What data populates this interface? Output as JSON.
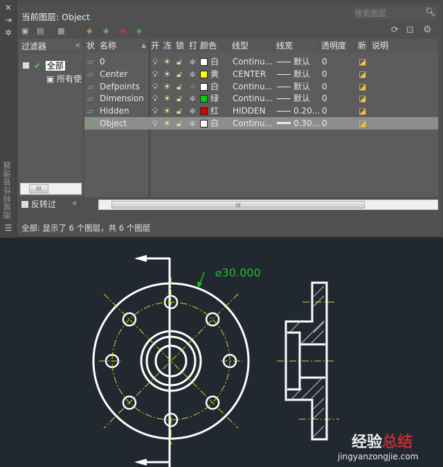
{
  "panel": {
    "title": "当前图层: Object",
    "search_placeholder": "搜索图层",
    "vertical_title": "图层特性管理器",
    "status": "全部: 显示了 6 个图层，共 6 个图层"
  },
  "filters": {
    "header": "过滤器",
    "root": "全部",
    "child": "所有使",
    "invert_label": "反转过"
  },
  "columns": [
    "状",
    "名称",
    "开",
    "冻",
    "锁",
    "打",
    "颜色",
    "线型",
    "线宽",
    "透明度",
    "新",
    "说明"
  ],
  "layers": [
    {
      "name": "0",
      "color_name": "白",
      "color": "#ffffff",
      "linetype": "Continu...",
      "lineweight": "默认",
      "transparency": "0",
      "current": false
    },
    {
      "name": "Center",
      "color_name": "黄",
      "color": "#ffff00",
      "linetype": "CENTER",
      "lineweight": "默认",
      "transparency": "0",
      "current": false
    },
    {
      "name": "Defpoints",
      "color_name": "白",
      "color": "#ffffff",
      "linetype": "Continu...",
      "lineweight": "默认",
      "transparency": "0",
      "current": false
    },
    {
      "name": "Dimension",
      "color_name": "绿",
      "color": "#00d000",
      "linetype": "Continu...",
      "lineweight": "默认",
      "transparency": "0",
      "current": false
    },
    {
      "name": "Hidden",
      "color_name": "红",
      "color": "#dd0000",
      "linetype": "HIDDEN",
      "lineweight": "0.20...",
      "transparency": "0",
      "current": false
    },
    {
      "name": "Object",
      "color_name": "白",
      "color": "#ffffff",
      "linetype": "Continu...",
      "lineweight": "0.30...",
      "transparency": "0",
      "current": true
    }
  ],
  "drawing": {
    "dimension": "⌀30.000",
    "watermark": "经验总结 jingyanzongjie.com"
  }
}
